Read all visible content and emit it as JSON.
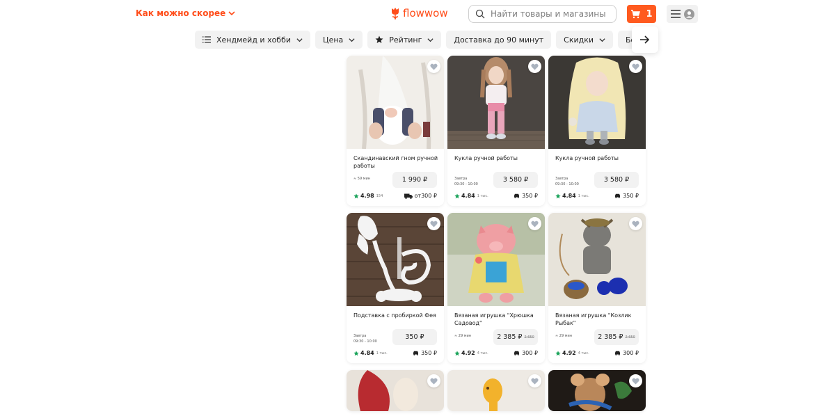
{
  "header": {
    "delivery_label": "Как можно скорее",
    "logo_text": "flowwow",
    "search_placeholder": "Найти товары и магазины",
    "cart_count": "1"
  },
  "filters": [
    {
      "label": "Хендмейд и хобби",
      "icon": "list-icon",
      "dropdown": true
    },
    {
      "label": "Цена",
      "dropdown": true
    },
    {
      "label": "Рейтинг",
      "icon": "star-icon",
      "dropdown": true
    },
    {
      "label": "Доставка до 90 минут",
      "dropdown": false
    },
    {
      "label": "Скидки",
      "dropdown": true
    },
    {
      "label": "Бонусы WowP",
      "dropdown": false
    }
  ],
  "products": [
    {
      "title": "Скандинавский гном ручной работы",
      "delivery_line1": "≈ 59 мин",
      "delivery_line2": "",
      "price": "1 990 ₽",
      "old_price": "",
      "rating": "4.98",
      "reviews": "154",
      "shipping": "от300 ₽",
      "ship_icon": "truck-icon"
    },
    {
      "title": "Кукла ручной работы",
      "delivery_line1": "Завтра",
      "delivery_line2": "09:30 - 10:00",
      "price": "3 580 ₽",
      "old_price": "",
      "rating": "4.84",
      "reviews": "1 тыс.",
      "shipping": "350 ₽",
      "ship_icon": "car-icon"
    },
    {
      "title": "Кукла ручной работы",
      "delivery_line1": "Завтра",
      "delivery_line2": "09:30 - 10:00",
      "price": "3 580 ₽",
      "old_price": "",
      "rating": "4.84",
      "reviews": "1 тыс.",
      "shipping": "350 ₽",
      "ship_icon": "car-icon"
    },
    {
      "title": "Подставка с пробиркой Фея",
      "delivery_line1": "Завтра",
      "delivery_line2": "09:30 - 10:00",
      "price": "350 ₽",
      "old_price": "",
      "rating": "4.84",
      "reviews": "1 тыс.",
      "shipping": "350 ₽",
      "ship_icon": "car-icon"
    },
    {
      "title": "Вязаная игрушка \"Хрюшка Садовод\"",
      "delivery_line1": "≈ 29 мин",
      "delivery_line2": "",
      "price": "2 385 ₽",
      "old_price": "2 650",
      "rating": "4.92",
      "reviews": "4 тыс.",
      "shipping": "300 ₽",
      "ship_icon": "car-icon"
    },
    {
      "title": "Вязаная игрушка \"Козлик Рыбак\"",
      "delivery_line1": "≈ 29 мин",
      "delivery_line2": "",
      "price": "2 385 ₽",
      "old_price": "2 650",
      "rating": "4.92",
      "reviews": "4 тыс.",
      "shipping": "300 ₽",
      "ship_icon": "car-icon"
    }
  ],
  "colors": {
    "accent": "#ff5a1f",
    "star": "#1aa35a"
  }
}
